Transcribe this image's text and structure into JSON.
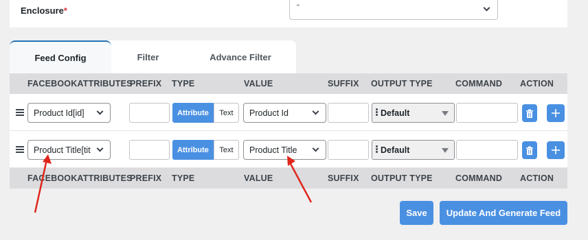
{
  "enclosure": {
    "label": "Enclosure",
    "required_mark": "*",
    "value": "\""
  },
  "tabs": [
    {
      "label": "Feed Config",
      "active": true
    },
    {
      "label": "Filter",
      "active": false
    },
    {
      "label": "Advance Filter",
      "active": false
    }
  ],
  "columns": [
    "FACEBOOKATTRIBUTES",
    "PREFIX",
    "TYPE",
    "VALUE",
    "SUFFIX",
    "OUTPUT TYPE",
    "COMMAND",
    "ACTION"
  ],
  "rows": [
    {
      "attribute": "Product Id[id]",
      "prefix": "",
      "type_attribute": "Attribute",
      "type_text": "Text",
      "value": "Product Id",
      "suffix": "",
      "output_type": "Default",
      "command": ""
    },
    {
      "attribute": "Product Title[tit",
      "prefix": "",
      "type_attribute": "Attribute",
      "type_text": "Text",
      "value": "Product Title",
      "suffix": "",
      "output_type": "Default",
      "command": ""
    }
  ],
  "buttons": {
    "save": "Save",
    "update_generate": "Update And Generate Feed"
  },
  "icons": {
    "delete": "trash-icon",
    "add": "plus-icon",
    "drag": "drag-handle-icon"
  },
  "colors": {
    "accent": "#4a90e2",
    "annotation": "#e0261b",
    "required": "#d63638"
  }
}
